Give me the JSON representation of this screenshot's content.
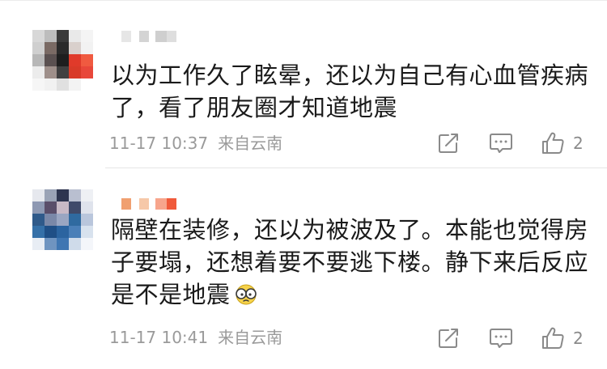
{
  "comments": [
    {
      "text": "以为工作久了眩晕，还以为自己有心血管疾病\n了，看了朋友圈才知道地震",
      "time": "11-17 10:37",
      "location": "来自云南",
      "likes": "2",
      "avatar_colors": [
        "#d8d8d8",
        "#bdbdbd",
        "#3a3a3a",
        "#e9e9e9",
        "#f4f4f4",
        "#cfcfcf",
        "#7a6a64",
        "#2a2a2a",
        "#d9d0cc",
        "#f2f2f2",
        "#b7b7b7",
        "#5a5050",
        "#1e1e1e",
        "#e03a2a",
        "#f05a40",
        "#ececec",
        "#9e8f8a",
        "#404040",
        "#d83a28",
        "#e8473a",
        "#f6f6f6",
        "#f1f1f1",
        "#e0e0e0",
        "#f3f3f3",
        "#ffffff"
      ],
      "username_colors": [
        "#e6e6e6",
        "#ffffff",
        "#d4d4d4",
        "#ffffff",
        "#cfcfcf",
        "#dedede"
      ]
    },
    {
      "text": "隔壁在装修，还以为被波及了。本能也觉得房\n子要塌，还想着要不要逃下楼。静下来后反应\n是不是地震",
      "time": "11-17 10:41",
      "location": "来自云南",
      "likes": "2",
      "avatar_colors": [
        "#e6e8ee",
        "#9aa3b6",
        "#2e3550",
        "#b9bfd0",
        "#eef0f4",
        "#8e99b3",
        "#5a4e6a",
        "#c8b9c6",
        "#3f4a6a",
        "#dfe3ec",
        "#2f5a8a",
        "#7a88a8",
        "#9aa6c2",
        "#2f6aa0",
        "#b9c6dc",
        "#3570a8",
        "#1f4f86",
        "#2b64a0",
        "#4a7fb8",
        "#d8e2ee",
        "#e8edf4",
        "#6f94c0",
        "#3f76b2",
        "#cfdbea",
        "#f4f6fa"
      ],
      "username_colors": [
        "#f0a070",
        "#ffffff",
        "#f6c8a8",
        "#ffffff",
        "#f7a58c",
        "#f05a3a"
      ]
    }
  ],
  "icons": {
    "share": "share-icon",
    "comment": "comment-icon",
    "like": "like-icon",
    "emoji": "glasses-face-emoji"
  }
}
